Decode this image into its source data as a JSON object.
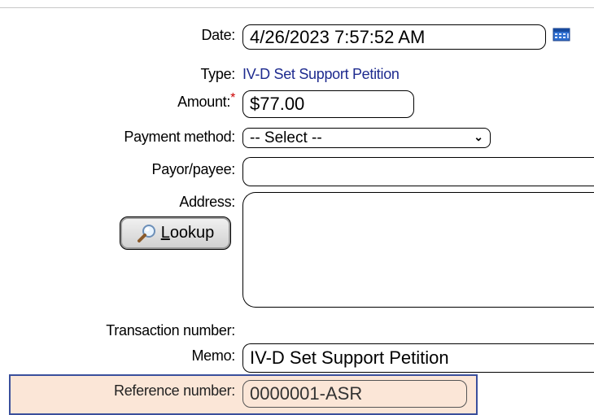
{
  "form": {
    "date": {
      "label": "Date:",
      "value": "4/26/2023 7:57:52 AM"
    },
    "type": {
      "label": "Type:",
      "value": "IV-D Set Support Petition"
    },
    "amount": {
      "label": "Amount:",
      "required_marker": "*",
      "value": "$77.00"
    },
    "payment_method": {
      "label": "Payment method:",
      "selected": "-- Select --"
    },
    "payor": {
      "label": "Payor/payee:",
      "value": ""
    },
    "address": {
      "label": "Address:",
      "value": ""
    },
    "lookup_button": {
      "label_first": "L",
      "label_rest": "ookup"
    },
    "transaction_number": {
      "label": "Transaction number:"
    },
    "memo": {
      "label": "Memo:",
      "value": "IV-D Set Support Petition"
    },
    "reference_number": {
      "label": "Reference number:",
      "value": "0000001-ASR"
    }
  },
  "colors": {
    "link_text": "#1e2b8f",
    "required": "#cc0000",
    "highlight_row": "#fbe6d7",
    "highlight_border": "#3a4f9c"
  },
  "icons": {
    "calendar": "calendar-icon",
    "search": "magnifier-icon",
    "dropdown": "chevron-down-icon"
  }
}
